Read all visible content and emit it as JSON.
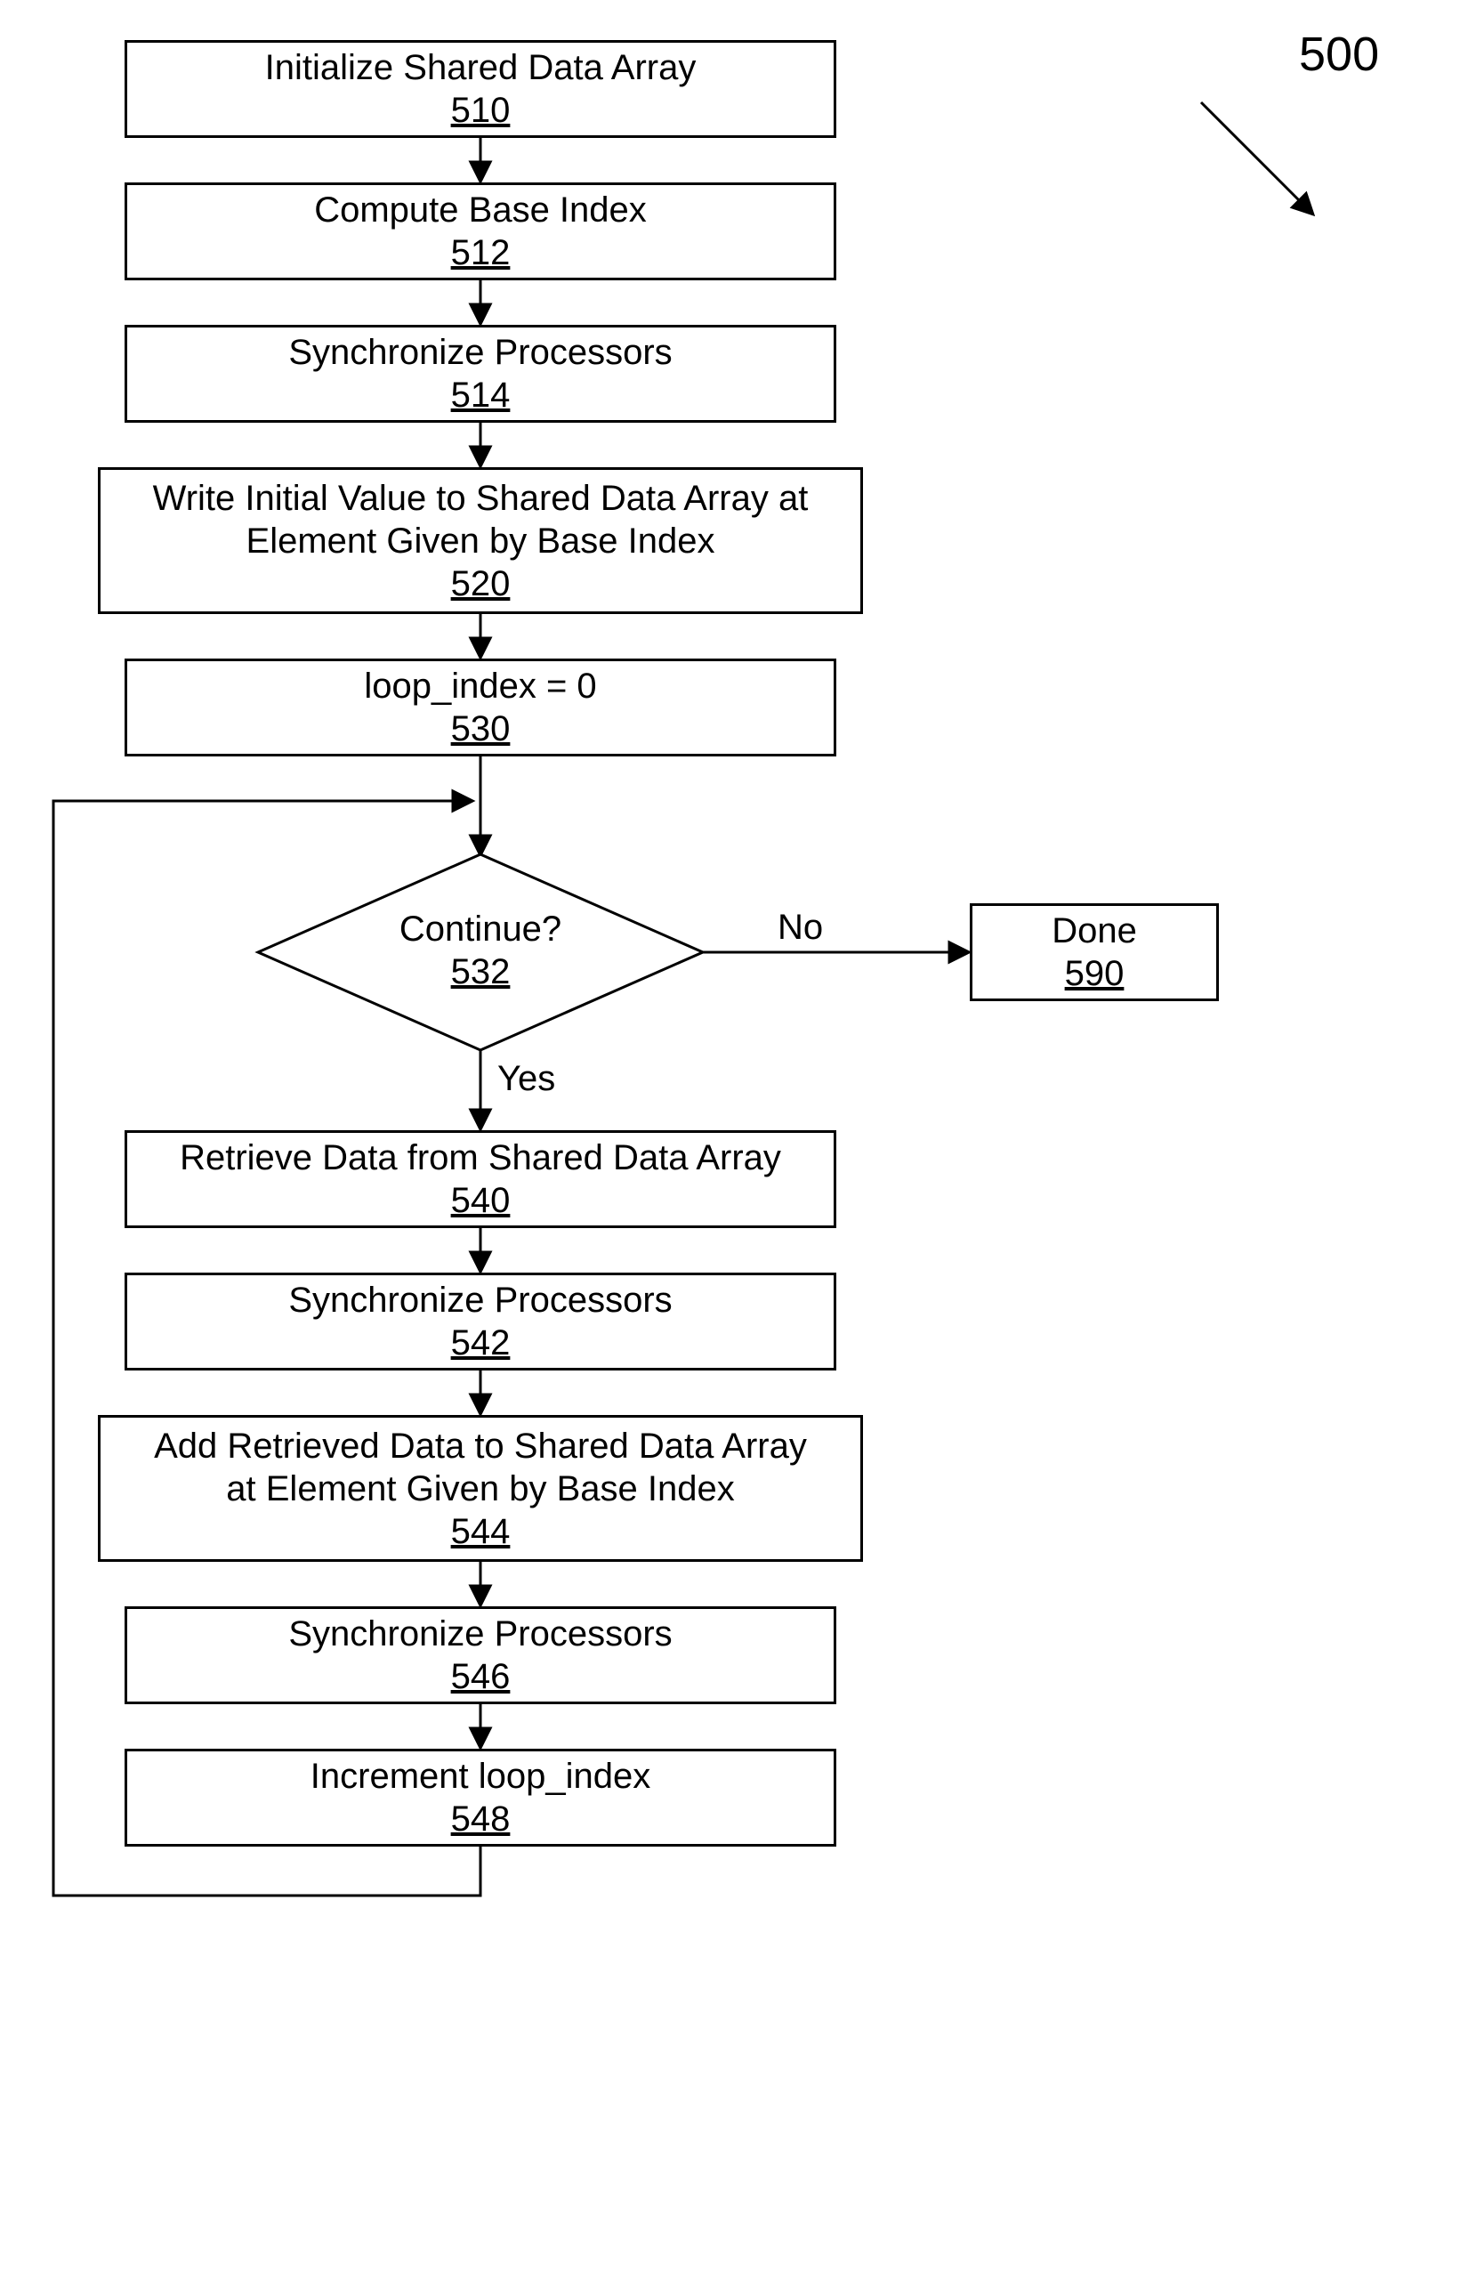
{
  "fig_ref": "500",
  "boxes": {
    "b510": {
      "title": "Initialize Shared Data Array",
      "ref": "510"
    },
    "b512": {
      "title": "Compute Base Index",
      "ref": "512"
    },
    "b514": {
      "title": "Synchronize Processors",
      "ref": "514"
    },
    "b520": {
      "title_l1": "Write Initial Value to Shared Data Array at",
      "title_l2": "Element Given by Base Index",
      "ref": "520"
    },
    "b530": {
      "title": "loop_index = 0",
      "ref": "530"
    },
    "d532": {
      "title": "Continue?",
      "ref": "532"
    },
    "b590": {
      "title": "Done",
      "ref": "590"
    },
    "b540": {
      "title": "Retrieve Data from Shared Data Array",
      "ref": "540"
    },
    "b542": {
      "title": "Synchronize Processors",
      "ref": "542"
    },
    "b544": {
      "title_l1": "Add Retrieved Data to Shared Data Array",
      "title_l2": "at Element Given by Base Index",
      "ref": "544"
    },
    "b546": {
      "title": "Synchronize Processors",
      "ref": "546"
    },
    "b548": {
      "title": "Increment loop_index",
      "ref": "548"
    }
  },
  "labels": {
    "yes": "Yes",
    "no": "No"
  }
}
